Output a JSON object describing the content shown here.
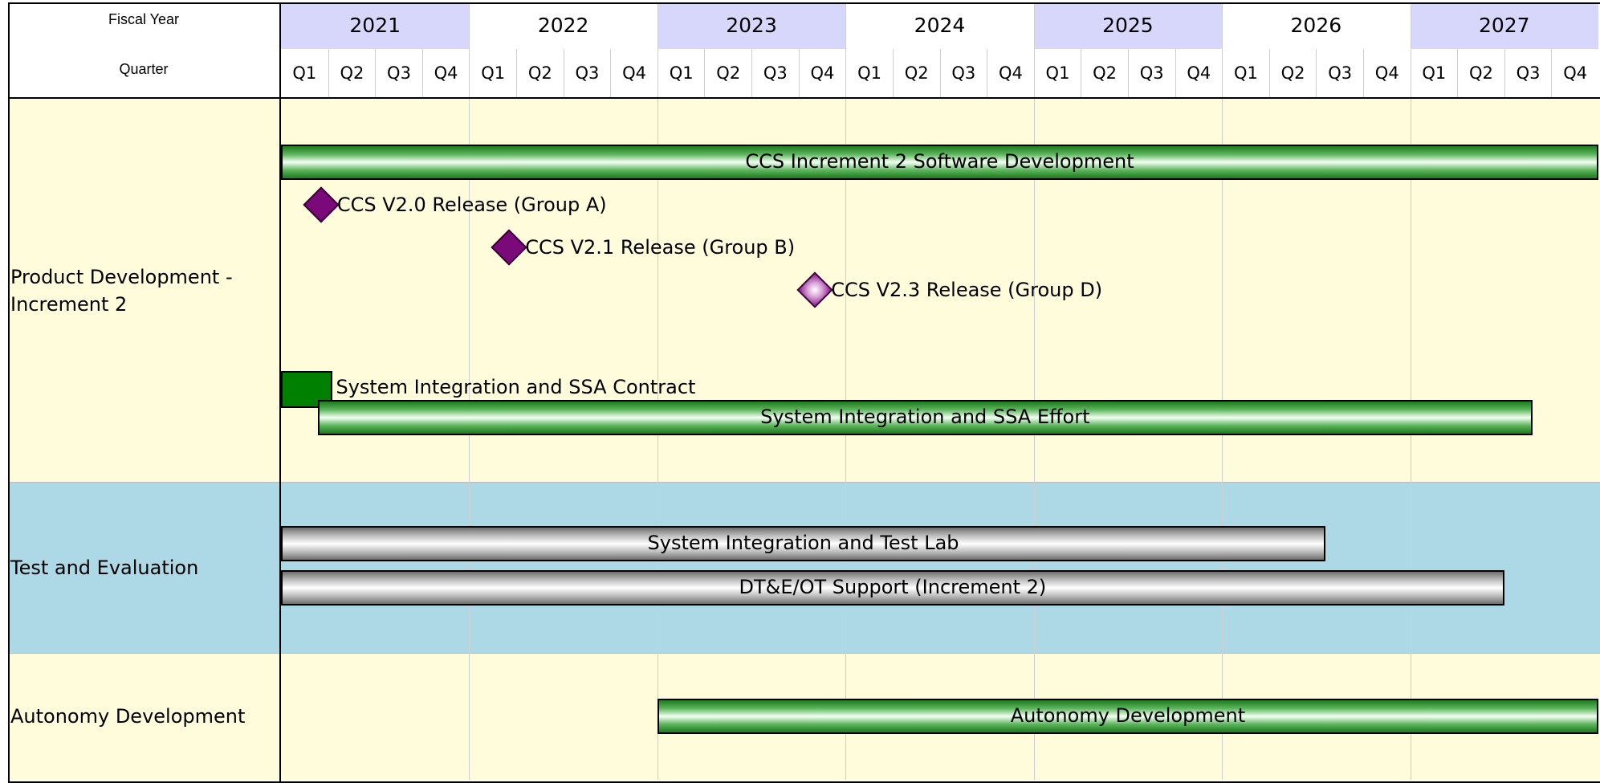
{
  "header": {
    "fiscal_year_label": "Fiscal Year",
    "quarter_label": "Quarter",
    "years": [
      "2021",
      "2022",
      "2023",
      "2024",
      "2025",
      "2026",
      "2027"
    ],
    "quarters": [
      "Q1",
      "Q2",
      "Q3",
      "Q4"
    ]
  },
  "swimlanes": [
    {
      "label": "Product Development - Increment 2",
      "color": "#fffcdc"
    },
    {
      "label": "Test and Evaluation",
      "color": "#add8e6"
    },
    {
      "label": "Autonomy Development",
      "color": "#fffcdc"
    }
  ],
  "tasks": [
    {
      "lane": 0,
      "label": "CCS Increment 2 Software Development",
      "style": "green",
      "start": "2021 Q1",
      "end": "2027 Q4"
    },
    {
      "lane": 0,
      "label": "System Integration and SSA Contract",
      "style": "solid-green",
      "start": "2021 Q1",
      "end": "2021 Q2",
      "label_outside": true
    },
    {
      "lane": 0,
      "label": "System Integration and SSA Effort",
      "style": "green",
      "start": "2021 Q1",
      "end": "2027 Q3"
    },
    {
      "lane": 1,
      "label": "System Integration and Test Lab",
      "style": "gray",
      "start": "2021 Q1",
      "end": "2026 Q2"
    },
    {
      "lane": 1,
      "label": "DT&E/OT Support (Increment 2)",
      "style": "gray",
      "start": "2021 Q1",
      "end": "2027 Q2"
    },
    {
      "lane": 2,
      "label": "Autonomy Development",
      "style": "green",
      "start": "2023 Q1",
      "end": "2027 Q4"
    }
  ],
  "milestones": [
    {
      "lane": 0,
      "label": "CCS V2.0 Release (Group A)",
      "date": "2021 Q1",
      "style": "dark"
    },
    {
      "lane": 0,
      "label": "CCS V2.1 Release (Group B)",
      "date": "2022 Q1",
      "style": "dark"
    },
    {
      "lane": 0,
      "label": "CCS V2.3 Release (Group D)",
      "date": "2023 Q4",
      "style": "light"
    }
  ],
  "colors": {
    "year_highlight": "#d7d7fc",
    "grid": "#cfcfcf",
    "border": "#000000",
    "green_bar": "#2e8b2e",
    "gray_bar": "#a9a9a9",
    "milestone": "#7a0a7a"
  }
}
